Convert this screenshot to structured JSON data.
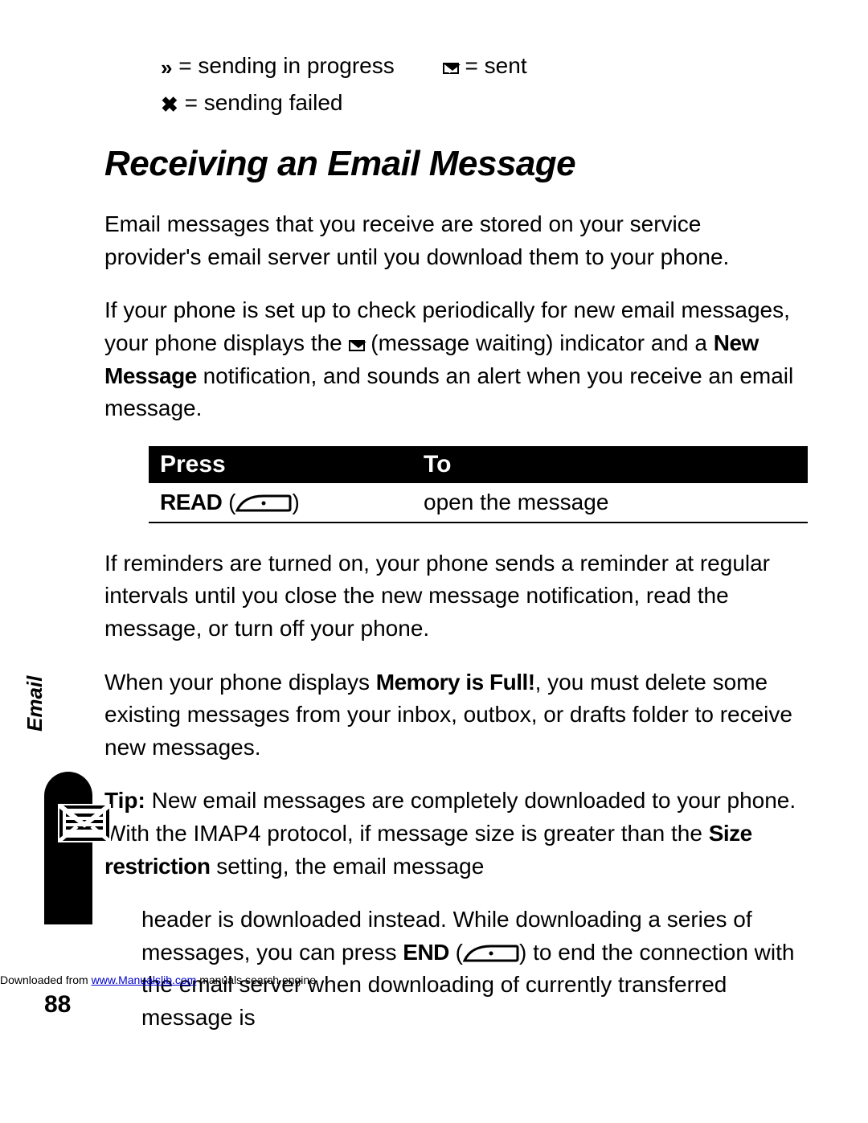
{
  "legend": {
    "sending": "= sending in progress",
    "sent": "= sent",
    "failed": "= sending failed"
  },
  "heading": "Receiving an Email Message",
  "para1": "Email messages that you receive are stored on your service provider's email server until you download them to your phone.",
  "para2a": "If your phone is set up to check periodically for new email messages, your phone displays the ",
  "para2b": " (message waiting) indicator and a ",
  "newMessage": "New Message",
  "para2c": " notification, and sounds an alert when you receive an email message.",
  "table": {
    "h1": "Press",
    "h2": "To",
    "readLabel": "READ",
    "readAction": "open the message"
  },
  "para3": "If reminders are turned on, your phone sends a reminder at regular intervals until you close the new message notification, read the message, or turn off your phone.",
  "para4a": "When your phone displays ",
  "memFull": "Memory is Full!",
  "para4b": ", you must delete some existing messages from your inbox, outbox, or drafts folder to receive new messages.",
  "tipLabel": "Tip:",
  "para5a": " New email messages are completely downloaded to your phone. With the IMAP4 protocol, if message size is greater than the ",
  "sizeRestriction": "Size restriction",
  "para5b": " setting, the email message ",
  "para5c": "header is downloaded instead. While downloading a series of messages, you can press ",
  "endLabel": "END",
  "para5d": " to end the connection with the email server when downloading of currently transferred message is",
  "sideLabel": "Email",
  "pageNum": "88",
  "footer": {
    "prefix": "Downloaded from ",
    "link": "www.Manualslib.com",
    "suffix": " manuals search engine"
  }
}
